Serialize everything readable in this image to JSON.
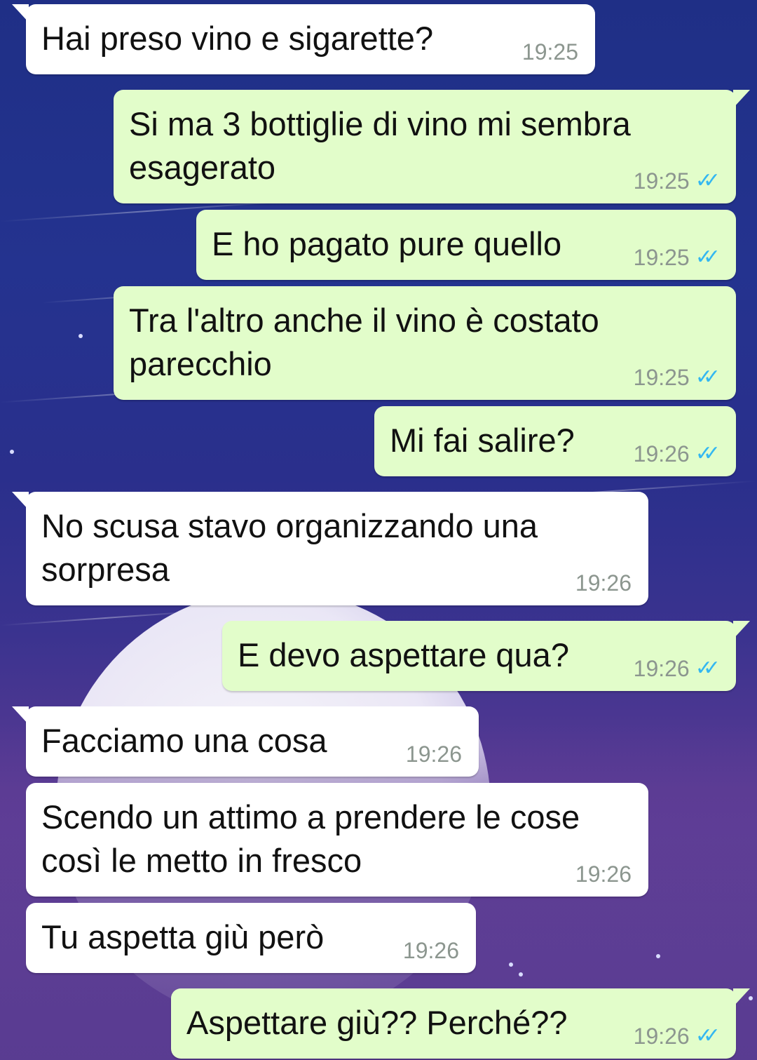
{
  "colors": {
    "incoming_bubble": "#ffffff",
    "outgoing_bubble": "#e2fdca",
    "read_receipt": "#34b7f1",
    "timestamp": "#8c968f"
  },
  "messages": [
    {
      "direction": "in",
      "text": "Hai preso vino e sigarette?",
      "time": "19:25"
    },
    {
      "direction": "out",
      "text": "Si ma 3 bottiglie di vino mi sembra esagerato",
      "time": "19:25",
      "status_icon": "double-check-icon"
    },
    {
      "direction": "out",
      "text": "E ho pagato pure quello",
      "time": "19:25",
      "status_icon": "double-check-icon"
    },
    {
      "direction": "out",
      "text": "Tra l'altro anche il vino è costato parecchio",
      "time": "19:25",
      "status_icon": "double-check-icon"
    },
    {
      "direction": "out",
      "text": "Mi fai salire?",
      "time": "19:26",
      "status_icon": "double-check-icon"
    },
    {
      "direction": "in",
      "text": "No scusa stavo organizzando una sorpresa",
      "time": "19:26"
    },
    {
      "direction": "out",
      "text": "E devo aspettare qua?",
      "time": "19:26",
      "status_icon": "double-check-icon"
    },
    {
      "direction": "in",
      "text": "Facciamo una cosa",
      "time": "19:26"
    },
    {
      "direction": "in",
      "text": "Scendo un attimo a prendere le cose così le metto in fresco",
      "time": "19:26"
    },
    {
      "direction": "in",
      "text": "Tu aspetta giù però",
      "time": "19:26"
    },
    {
      "direction": "out",
      "text": "Aspettare giù?? Perché??",
      "time": "19:26",
      "status_icon": "double-check-icon"
    }
  ]
}
